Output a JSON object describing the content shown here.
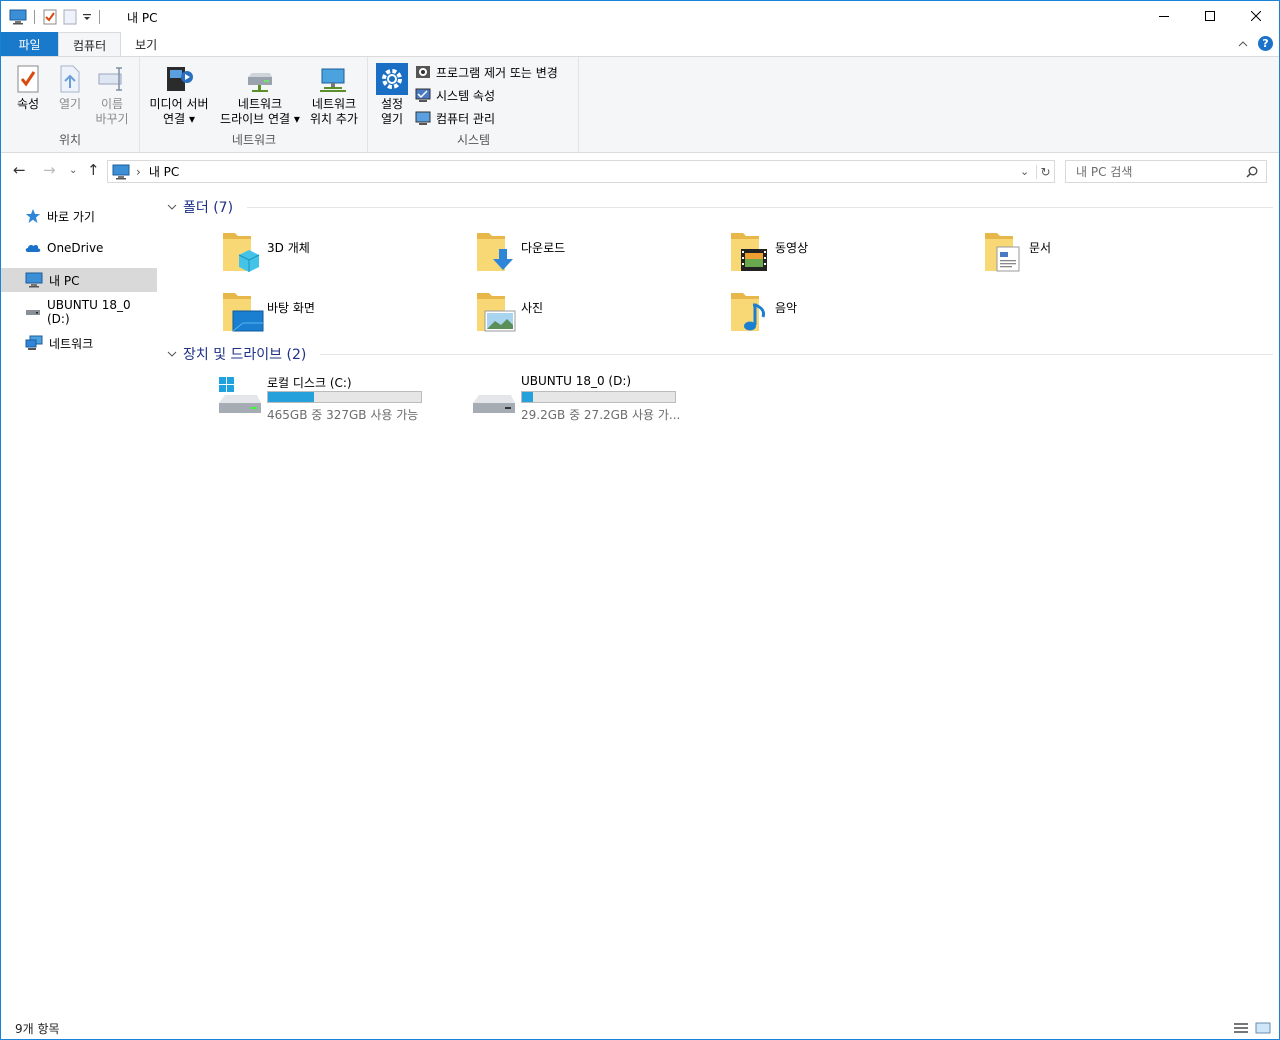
{
  "window": {
    "title": "내 PC"
  },
  "tabs": {
    "file": "파일",
    "computer": "컴퓨터",
    "view": "보기"
  },
  "ribbon": {
    "location": {
      "label": "위치",
      "properties": "속성",
      "open": "열기",
      "rename1": "이름",
      "rename2": "바꾸기"
    },
    "network": {
      "label": "네트워크",
      "media1": "미디어 서버",
      "media2": "연결",
      "drive1": "네트워크",
      "drive2": "드라이브 연결",
      "addloc1": "네트워크",
      "addloc2": "위치 추가"
    },
    "system": {
      "label": "시스템",
      "settings1": "설정",
      "settings2": "열기",
      "uninstall": "프로그램 제거 또는 변경",
      "sysprops": "시스템 속성",
      "manage": "컴퓨터 관리"
    }
  },
  "address": {
    "path": "내 PC",
    "search_placeholder": "내 PC 검색"
  },
  "nav": {
    "items": [
      {
        "label": "바로 가기"
      },
      {
        "label": "OneDrive"
      },
      {
        "label": "내 PC"
      },
      {
        "label": "UBUNTU 18_0 (D:)"
      },
      {
        "label": "네트워크"
      }
    ]
  },
  "folders": {
    "header": "폴더 (7)",
    "items": [
      {
        "label": "3D 개체"
      },
      {
        "label": "다운로드"
      },
      {
        "label": "동영상"
      },
      {
        "label": "문서"
      },
      {
        "label": "바탕 화면"
      },
      {
        "label": "사진"
      },
      {
        "label": "음악"
      }
    ]
  },
  "drives": {
    "header": "장치 및 드라이브 (2)",
    "items": [
      {
        "label": "로컬 디스크 (C:)",
        "free": "465GB 중 327GB 사용 가능",
        "used_fraction": 0.3
      },
      {
        "label": "UBUNTU 18_0 (D:)",
        "free": "29.2GB 중 27.2GB 사용 가...",
        "used_fraction": 0.07
      }
    ]
  },
  "status": {
    "count": "9개 항목"
  },
  "colors": {
    "accent": "#1979ca",
    "bar": "#26a0da",
    "section": "#1e3287",
    "folder": "#f4c542"
  }
}
